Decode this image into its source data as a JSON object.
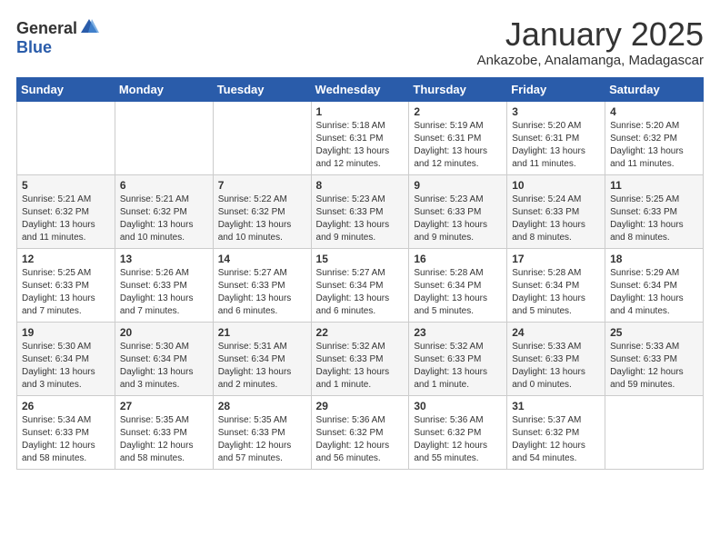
{
  "header": {
    "logo_general": "General",
    "logo_blue": "Blue",
    "title": "January 2025",
    "location": "Ankazobe, Analamanga, Madagascar"
  },
  "weekdays": [
    "Sunday",
    "Monday",
    "Tuesday",
    "Wednesday",
    "Thursday",
    "Friday",
    "Saturday"
  ],
  "weeks": [
    [
      {
        "day": "",
        "info": ""
      },
      {
        "day": "",
        "info": ""
      },
      {
        "day": "",
        "info": ""
      },
      {
        "day": "1",
        "info": "Sunrise: 5:18 AM\nSunset: 6:31 PM\nDaylight: 13 hours\nand 12 minutes."
      },
      {
        "day": "2",
        "info": "Sunrise: 5:19 AM\nSunset: 6:31 PM\nDaylight: 13 hours\nand 12 minutes."
      },
      {
        "day": "3",
        "info": "Sunrise: 5:20 AM\nSunset: 6:31 PM\nDaylight: 13 hours\nand 11 minutes."
      },
      {
        "day": "4",
        "info": "Sunrise: 5:20 AM\nSunset: 6:32 PM\nDaylight: 13 hours\nand 11 minutes."
      }
    ],
    [
      {
        "day": "5",
        "info": "Sunrise: 5:21 AM\nSunset: 6:32 PM\nDaylight: 13 hours\nand 11 minutes."
      },
      {
        "day": "6",
        "info": "Sunrise: 5:21 AM\nSunset: 6:32 PM\nDaylight: 13 hours\nand 10 minutes."
      },
      {
        "day": "7",
        "info": "Sunrise: 5:22 AM\nSunset: 6:32 PM\nDaylight: 13 hours\nand 10 minutes."
      },
      {
        "day": "8",
        "info": "Sunrise: 5:23 AM\nSunset: 6:33 PM\nDaylight: 13 hours\nand 9 minutes."
      },
      {
        "day": "9",
        "info": "Sunrise: 5:23 AM\nSunset: 6:33 PM\nDaylight: 13 hours\nand 9 minutes."
      },
      {
        "day": "10",
        "info": "Sunrise: 5:24 AM\nSunset: 6:33 PM\nDaylight: 13 hours\nand 8 minutes."
      },
      {
        "day": "11",
        "info": "Sunrise: 5:25 AM\nSunset: 6:33 PM\nDaylight: 13 hours\nand 8 minutes."
      }
    ],
    [
      {
        "day": "12",
        "info": "Sunrise: 5:25 AM\nSunset: 6:33 PM\nDaylight: 13 hours\nand 7 minutes."
      },
      {
        "day": "13",
        "info": "Sunrise: 5:26 AM\nSunset: 6:33 PM\nDaylight: 13 hours\nand 7 minutes."
      },
      {
        "day": "14",
        "info": "Sunrise: 5:27 AM\nSunset: 6:33 PM\nDaylight: 13 hours\nand 6 minutes."
      },
      {
        "day": "15",
        "info": "Sunrise: 5:27 AM\nSunset: 6:34 PM\nDaylight: 13 hours\nand 6 minutes."
      },
      {
        "day": "16",
        "info": "Sunrise: 5:28 AM\nSunset: 6:34 PM\nDaylight: 13 hours\nand 5 minutes."
      },
      {
        "day": "17",
        "info": "Sunrise: 5:28 AM\nSunset: 6:34 PM\nDaylight: 13 hours\nand 5 minutes."
      },
      {
        "day": "18",
        "info": "Sunrise: 5:29 AM\nSunset: 6:34 PM\nDaylight: 13 hours\nand 4 minutes."
      }
    ],
    [
      {
        "day": "19",
        "info": "Sunrise: 5:30 AM\nSunset: 6:34 PM\nDaylight: 13 hours\nand 3 minutes."
      },
      {
        "day": "20",
        "info": "Sunrise: 5:30 AM\nSunset: 6:34 PM\nDaylight: 13 hours\nand 3 minutes."
      },
      {
        "day": "21",
        "info": "Sunrise: 5:31 AM\nSunset: 6:34 PM\nDaylight: 13 hours\nand 2 minutes."
      },
      {
        "day": "22",
        "info": "Sunrise: 5:32 AM\nSunset: 6:33 PM\nDaylight: 13 hours\nand 1 minute."
      },
      {
        "day": "23",
        "info": "Sunrise: 5:32 AM\nSunset: 6:33 PM\nDaylight: 13 hours\nand 1 minute."
      },
      {
        "day": "24",
        "info": "Sunrise: 5:33 AM\nSunset: 6:33 PM\nDaylight: 13 hours\nand 0 minutes."
      },
      {
        "day": "25",
        "info": "Sunrise: 5:33 AM\nSunset: 6:33 PM\nDaylight: 12 hours\nand 59 minutes."
      }
    ],
    [
      {
        "day": "26",
        "info": "Sunrise: 5:34 AM\nSunset: 6:33 PM\nDaylight: 12 hours\nand 58 minutes."
      },
      {
        "day": "27",
        "info": "Sunrise: 5:35 AM\nSunset: 6:33 PM\nDaylight: 12 hours\nand 58 minutes."
      },
      {
        "day": "28",
        "info": "Sunrise: 5:35 AM\nSunset: 6:33 PM\nDaylight: 12 hours\nand 57 minutes."
      },
      {
        "day": "29",
        "info": "Sunrise: 5:36 AM\nSunset: 6:32 PM\nDaylight: 12 hours\nand 56 minutes."
      },
      {
        "day": "30",
        "info": "Sunrise: 5:36 AM\nSunset: 6:32 PM\nDaylight: 12 hours\nand 55 minutes."
      },
      {
        "day": "31",
        "info": "Sunrise: 5:37 AM\nSunset: 6:32 PM\nDaylight: 12 hours\nand 54 minutes."
      },
      {
        "day": "",
        "info": ""
      }
    ]
  ]
}
